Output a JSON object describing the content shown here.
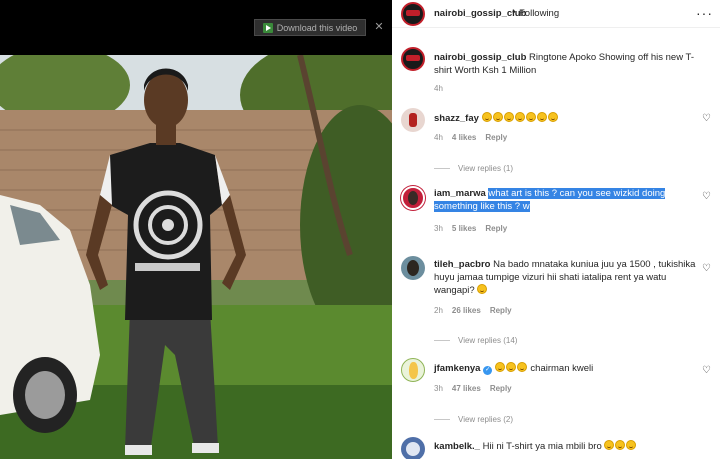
{
  "download_bar": {
    "label": "Download this video",
    "close_glyph": "✕"
  },
  "post": {
    "username": "nairobi_gossip_club",
    "separator": "•",
    "follow_status": "Following",
    "more_glyph": "···",
    "caption": "Ringtone Apoko Showing off his new T-shirt Worth Ksh 1 Million",
    "time": "4h"
  },
  "comments": [
    {
      "username": "shazz_fay",
      "text": "",
      "emoji_count": 7,
      "time": "4h",
      "likes": "4 likes",
      "reply": "Reply",
      "view_replies": "View replies (1)"
    },
    {
      "username": "iam_marwa",
      "text_highlight": "what art is this ? can you see wizkid doing something like this ? w",
      "time": "3h",
      "likes": "5 likes",
      "reply": "Reply"
    },
    {
      "username": "tileh_pacbro",
      "text": "Na bado mnataka kuniua juu ya 1500 , tukishika huyu jamaa tumpige vizuri hii shati iatalipa rent ya watu wangapi?",
      "time": "2h",
      "likes": "26 likes",
      "reply": "Reply",
      "view_replies": "View replies (14)"
    },
    {
      "username": "jfamkenya",
      "verified": true,
      "verified_glyph": "✓",
      "text": "chairman kweli",
      "emoji_count": 3,
      "time": "3h",
      "likes": "47 likes",
      "reply": "Reply",
      "view_replies": "View replies (2)"
    },
    {
      "username": "kambelk._",
      "text": "Hii ni T-shirt ya mia mbili bro",
      "emoji_count": 3
    }
  ],
  "icons": {
    "heart": "heart-outline-icon",
    "download": "video-download-icon"
  },
  "colors": {
    "accent": "#0095f6",
    "brand_red": "#c21f2a",
    "highlight": "#3584e4"
  }
}
